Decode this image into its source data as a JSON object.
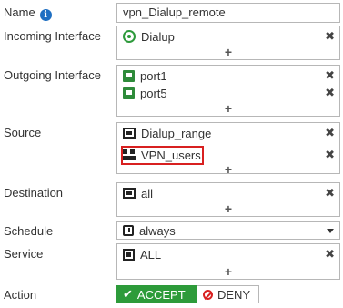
{
  "name": {
    "label": "Name",
    "value": "vpn_Dialup_remote"
  },
  "incoming": {
    "label": "Incoming Interface",
    "items": [
      "Dialup"
    ]
  },
  "outgoing": {
    "label": "Outgoing Interface",
    "items": [
      "port1",
      "port5"
    ]
  },
  "source": {
    "label": "Source",
    "items": [
      "Dialup_range",
      "VPN_users"
    ],
    "highlighted_item": "VPN_users"
  },
  "destination": {
    "label": "Destination",
    "items": [
      "all"
    ]
  },
  "schedule": {
    "label": "Schedule",
    "value": "always"
  },
  "service": {
    "label": "Service",
    "items": [
      "ALL"
    ]
  },
  "action": {
    "label": "Action",
    "accept_label": "ACCEPT",
    "deny_label": "DENY",
    "selected": "ACCEPT"
  },
  "glyphs": {
    "info": "i",
    "remove": "✖",
    "add": "+",
    "check": "✔"
  },
  "colors": {
    "accept_green": "#2d9b3a",
    "highlight_red": "#d82020",
    "info_blue": "#1f6fc2",
    "interface_green": "#2e8b3a"
  },
  "icons": {
    "info": "info-icon",
    "dialup": "dialup-interface-icon",
    "port": "port-icon",
    "address_range": "address-range-icon",
    "user_group": "user-group-icon",
    "address": "address-icon",
    "schedule": "schedule-icon",
    "service": "service-icon",
    "remove": "remove-icon",
    "add": "add-icon"
  }
}
